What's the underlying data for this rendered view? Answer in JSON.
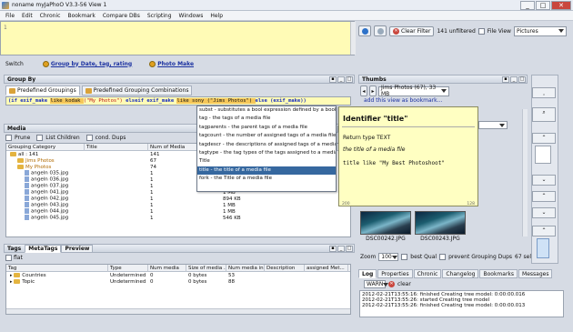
{
  "window": {
    "title": "noname myJaPhoO V3.3-56 View 1",
    "min": "_",
    "max": "□",
    "close": "✕"
  },
  "menu": [
    "File",
    "Edit",
    "Chronic",
    "Bookmark",
    "Compare DBs",
    "Scripting",
    "Windows",
    "Help"
  ],
  "editor": {
    "line_number": "1"
  },
  "toolbar": {
    "clear_filter": "Clear Filter",
    "unfiltered": "141 unfiltered",
    "file_view": "File View",
    "view_select": "Pictures"
  },
  "switchbar": {
    "label": "Switch",
    "group_by_date": "Group by Date, tag, rating",
    "photo_make": "Photo Make"
  },
  "group_by": {
    "title": "Group By",
    "tab_predefined": "Predefined Groupings",
    "tab_combinations": "Predefined Grouping Combinations",
    "expr_parts": [
      "(if exif_make ",
      "like kodak ",
      "(\"My Photos\") ",
      "elseif exif_make ",
      "like sony (\"Jims Photos\") ",
      "else (exif_make))"
    ]
  },
  "autocomplete": {
    "items": [
      "subst - substitutes a bool expression defined by a book...",
      "tag - the tags of a media file",
      "tagparents - the parent tags of a media file",
      "tagcount - the number of assigned tags of a media file",
      "tagdescr - the descriptions of assigned tags of a media f...",
      "tagtype - the tag types of the tags assigned to a media file",
      "Title",
      "title - the title of a media file",
      "fork - the Title of a media file"
    ],
    "selected_index": 7
  },
  "info": {
    "heading": "Identifier \"title\"",
    "return_type": "Return type TEXT",
    "description": "the title of a media file",
    "example": "title like \"My Best Photoshoot\"",
    "footer_left": "200",
    "footer_right": "128"
  },
  "media": {
    "title": "Media",
    "prune": "Prune",
    "list_children": "List Children",
    "cond_dups": "cond. Dups",
    "columns": [
      "Grouping Category",
      "Title",
      "Num of Media",
      ""
    ],
    "rows": [
      {
        "name": "all : 141",
        "title": "",
        "num": "141",
        "size": "",
        "type": "root"
      },
      {
        "name": "Jims Photos",
        "title": "",
        "num": "67",
        "size": "",
        "type": "folder"
      },
      {
        "name": "My Photos",
        "title": "",
        "num": "74",
        "size": "",
        "type": "folder"
      },
      {
        "name": "angeln 035.jpg",
        "title": "",
        "num": "1",
        "size": "",
        "type": "file"
      },
      {
        "name": "angeln 036.jpg",
        "title": "",
        "num": "1",
        "size": "",
        "type": "file"
      },
      {
        "name": "angeln 037.jpg",
        "title": "",
        "num": "1",
        "size": "724 KB",
        "type": "file"
      },
      {
        "name": "angeln 041.jpg",
        "title": "",
        "num": "1",
        "size": "1 MB",
        "type": "file"
      },
      {
        "name": "angeln 042.jpg",
        "title": "",
        "num": "1",
        "size": "894 KB",
        "type": "file"
      },
      {
        "name": "angeln 043.jpg",
        "title": "",
        "num": "1",
        "size": "1 MB",
        "type": "file"
      },
      {
        "name": "angeln 044.jpg",
        "title": "",
        "num": "1",
        "size": "1 MB",
        "type": "file"
      },
      {
        "name": "angeln 045.jpg",
        "title": "",
        "num": "1",
        "size": "546 KB",
        "type": "file"
      }
    ]
  },
  "thumbs": {
    "title": "Thumbs",
    "album": "Jims Photos (67), 33 MB",
    "add_bookmark": "add this view as bookmark...",
    "captions": [
      "DSC00242.JPG",
      "DSC00243.JPG"
    ],
    "zoom_label": "Zoom",
    "zoom_value": "100",
    "best_qual": "best Qual",
    "prevent_dups": "prevent Grouping Dups",
    "selected": "67 selec"
  },
  "tags": {
    "title": "Tags",
    "tab_metatags": "MetaTags",
    "tab_preview": "Preview",
    "flat": "flat",
    "columns": [
      "Tag",
      "Type",
      "Num media",
      "Size of media ...",
      "Num media in...",
      "Description",
      "assigned Met..."
    ],
    "rows": [
      {
        "tag": "Countries",
        "type": "Undetermined",
        "num": "0",
        "size": "0 bytes",
        "num_in": "53"
      },
      {
        "tag": "Topic",
        "type": "Undetermined",
        "num": "0",
        "size": "0 bytes",
        "num_in": "88"
      }
    ]
  },
  "log": {
    "tabs": [
      "Log",
      "Properties",
      "Chronic",
      "Changelog",
      "Bookmarks",
      "Messages"
    ],
    "level": "WARN",
    "clear": "clear",
    "lines": [
      "2012-02-21T13:55:16: finished Creating tree model: 0:00:00.016",
      "2012-02-21T13:55:26: started Creating tree model",
      "2012-02-21T13:55:26: finished Creating tree model: 0:00:00.013"
    ]
  },
  "colors": {
    "accent": "#36689f",
    "editor_bg": "#fffbb6",
    "info_bg": "#ffffc2"
  }
}
